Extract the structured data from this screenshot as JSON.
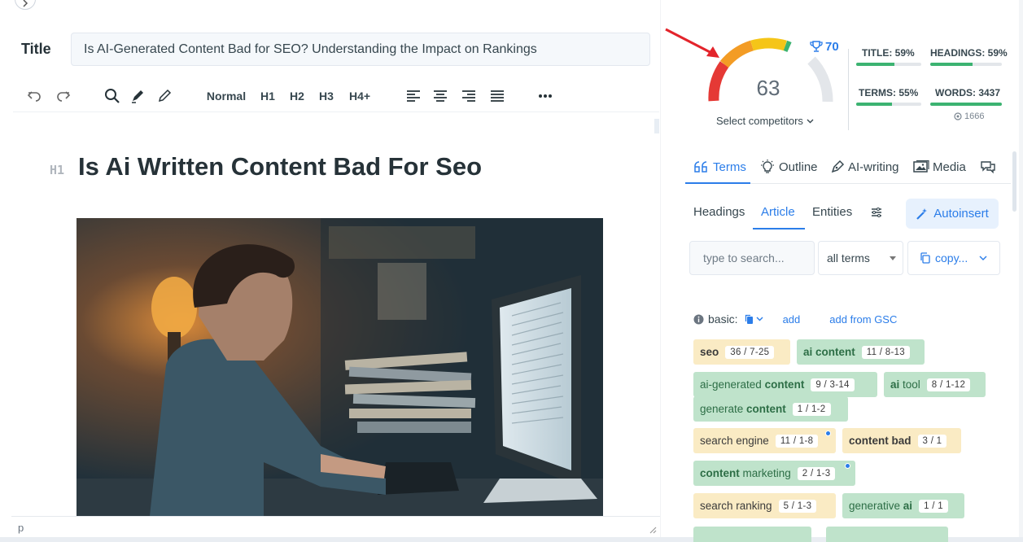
{
  "editor": {
    "title_label": "Title",
    "title_value": "Is AI-Generated Content Bad for SEO? Understanding the Impact on Rankings",
    "toolbar": {
      "normal": "Normal",
      "h1": "H1",
      "h2": "H2",
      "h3": "H3",
      "h4": "H4+"
    },
    "h1_tag": "H1",
    "heading": "Is Ai Written Content Bad For Seo",
    "status_node": "p"
  },
  "score": {
    "value": "63",
    "target": "70",
    "competitors_label": "Select competitors",
    "colors": {
      "red": "#e53935",
      "orange": "#f39c25",
      "yellow": "#f5c518",
      "green": "#3cb371",
      "track": "#e3e6ea"
    }
  },
  "metrics": {
    "title": {
      "label": "TITLE: 59%",
      "pct": 59
    },
    "headings": {
      "label": "HEADINGS: 59%",
      "pct": 59
    },
    "terms": {
      "label": "TERMS: 55%",
      "pct": 55
    },
    "words": {
      "label": "WORDS: 3437",
      "pct": 100,
      "sub": "1666"
    }
  },
  "panel_tabs": {
    "terms": "Terms",
    "outline": "Outline",
    "ai_writing": "AI-writing",
    "media": "Media"
  },
  "sub_tabs": {
    "headings": "Headings",
    "article": "Article",
    "entities": "Entities",
    "autoinsert": "Autoinsert"
  },
  "filters": {
    "search_placeholder": "type to search...",
    "terms_select": "all terms",
    "copy": "copy..."
  },
  "basic": {
    "label": "basic:",
    "add": "add",
    "add_gsc": "add from GSC"
  },
  "terms": [
    {
      "pre": "",
      "bold": "seo",
      "post": "",
      "count": "36 / 7-25",
      "color": "yellow"
    },
    {
      "pre": "",
      "bold": "ai content",
      "post": "",
      "count": "11 / 8-13",
      "color": "green"
    },
    {
      "pre": "ai-generated ",
      "bold": "content",
      "post": "",
      "count": "9 / 3-14",
      "color": "green"
    },
    {
      "pre": "",
      "bold": "ai",
      "post": " tool",
      "count": "8 / 1-12",
      "color": "green"
    },
    {
      "pre": "generate ",
      "bold": "content",
      "post": "",
      "count": "1 / 1-2",
      "color": "green"
    },
    {
      "pre": "search engine",
      "bold": "",
      "post": "",
      "count": "11 / 1-8",
      "color": "yellow"
    },
    {
      "pre": "",
      "bold": "content bad",
      "post": "",
      "count": "3 / 1",
      "color": "yellow"
    },
    {
      "pre": "",
      "bold": "content",
      "post": " marketing",
      "count": "2 / 1-3",
      "color": "green"
    },
    {
      "pre": "search ranking",
      "bold": "",
      "post": "",
      "count": "5 / 1-3",
      "color": "yellow"
    },
    {
      "pre": "generative ",
      "bold": "ai",
      "post": "",
      "count": "1 / 1",
      "color": "green"
    }
  ]
}
